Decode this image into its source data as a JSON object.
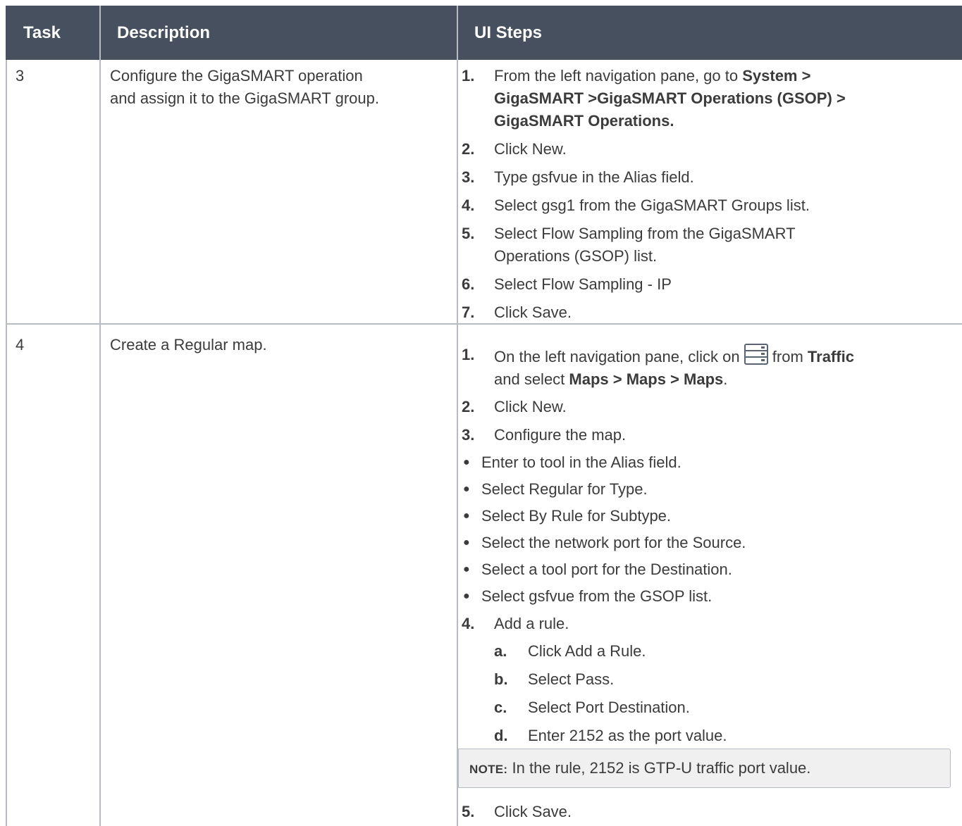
{
  "table": {
    "headers": [
      "Task",
      "Description",
      "UI Steps"
    ],
    "rows": [
      {
        "task": "3",
        "description": [
          "Configure the GigaSMART operation",
          "and assign it to the GigaSMART group."
        ],
        "steps": [
          {
            "num": "1.",
            "lines": [
              [
                {
                  "t": "From the left navigation pane, go to "
                },
                {
                  "t": "System >",
                  "b": true
                }
              ],
              [
                {
                  "t": "GigaSMART >GigaSMART Operations (GSOP) >",
                  "b": true
                }
              ],
              [
                {
                  "t": "GigaSMART Operations.",
                  "b": true
                }
              ]
            ]
          },
          {
            "num": "2.",
            "text": "Click New."
          },
          {
            "num": "3.",
            "text": "Type gsfvue in the Alias field."
          },
          {
            "num": "4.",
            "text": "Select gsg1 from the GigaSMART Groups list."
          },
          {
            "num": "5.",
            "lines": [
              [
                {
                  "t": "Select Flow Sampling from the GigaSMART"
                }
              ],
              [
                {
                  "t": "Operations (GSOP) list."
                }
              ]
            ]
          },
          {
            "num": "6.",
            "text": "Select Flow Sampling - IP"
          },
          {
            "num": "7.",
            "text": "Click Save."
          }
        ]
      },
      {
        "task": "4",
        "description": [
          "Create a Regular map."
        ],
        "step1": {
          "num": "1.",
          "line1_before_icon": "On the left navigation pane, click on ",
          "icon": "server-list-icon",
          "line1_after_icon": " from ",
          "line1_bold": "Traffic",
          "line2_prefix": "and select ",
          "line2_bold": "Maps > Maps > Maps",
          "line2_suffix": "."
        },
        "step2": {
          "num": "2.",
          "text": "Click New."
        },
        "step3": {
          "num": "3.",
          "text": "Configure the map."
        },
        "bullets": [
          "Enter to tool in the Alias field.",
          "Select Regular for Type.",
          "Select By Rule for Subtype.",
          "Select the network port for the Source.",
          "Select a tool port for the Destination.",
          "Select gsfvue from the GSOP list."
        ],
        "step4": {
          "num": "4.",
          "text": "Add a rule."
        },
        "substeps": [
          {
            "num": "a.",
            "text": "Click Add a Rule."
          },
          {
            "num": "b.",
            "text": "Select Pass."
          },
          {
            "num": "c.",
            "text": "Select Port Destination."
          },
          {
            "num": "d.",
            "text": "Enter 2152 as the port value."
          }
        ],
        "note": {
          "label": "NOTE:",
          "text": " In the rule, 2152 is GTP-U traffic port value."
        },
        "step5": {
          "num": "5.",
          "text": "Click Save."
        }
      }
    ]
  },
  "colors": {
    "header_bg": "#46505e",
    "border": "#b7bcc3",
    "note_bg": "#f0f0f0"
  }
}
